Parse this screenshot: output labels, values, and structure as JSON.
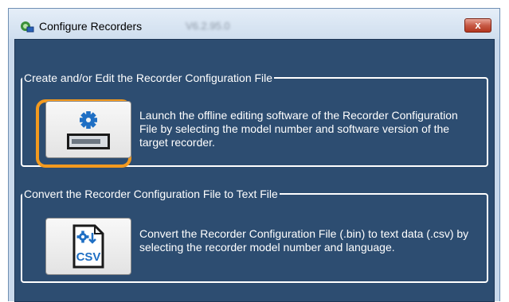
{
  "window": {
    "title": "Configure Recorders",
    "version": "V6.2.95.0",
    "close_label": "x"
  },
  "icons": {
    "app": "recorder-app-icon",
    "close": "close-icon",
    "settings": "gear-recorder-icon",
    "csv": "csv-document-icon"
  },
  "colors": {
    "panel": "#2d4d71",
    "highlight": "#f39a1f",
    "close": "#c75a46"
  },
  "groups": [
    {
      "title": "Create and/or Edit the Recorder Configuration File",
      "description": "Launch the offline editing software of the Recorder Configuration File by selecting the model number and software version of the target recorder."
    },
    {
      "title": "Convert the Recorder Configuration File to Text File",
      "description": "Convert the Recorder Configuration File (.bin) to text data (.csv) by selecting the recorder model number and language.",
      "icon_label": "CSV"
    }
  ]
}
